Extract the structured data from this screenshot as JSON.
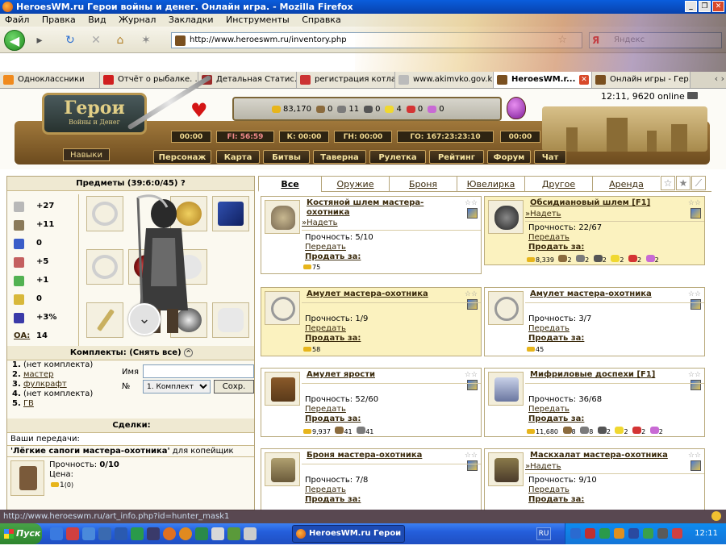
{
  "window": {
    "title": "HeroesWM.ru Герои войны и денег. Онлайн игра. - Mozilla Firefox"
  },
  "menu": [
    "Файл",
    "Правка",
    "Вид",
    "Журнал",
    "Закладки",
    "Инструменты",
    "Справка"
  ],
  "url": "http://www.heroeswm.ru/inventory.php",
  "search_placeholder": "Яндекс",
  "search_brand": "Я",
  "tabs": [
    {
      "label": "Одноклассники",
      "color": "#f08a1d"
    },
    {
      "label": "Отчёт о рыбалке. ...",
      "color": "#d01f1f"
    },
    {
      "label": "Детальная Статис...",
      "color": "#9b2a2a"
    },
    {
      "label": "регистрация котла...",
      "color": "#cc3333"
    },
    {
      "label": "www.akimvko.gov.k...",
      "color": "#bbbbbb"
    },
    {
      "label": "HeroesWM.r...",
      "color": "#7a5020"
    },
    {
      "label": "Онлайн игры - Гер...",
      "color": "#7a5020"
    }
  ],
  "game": {
    "logo": {
      "title": "Герои",
      "subtitle": "Войны и Денег"
    },
    "clock": "12:11, 9620 online",
    "resources": [
      {
        "value": "83,170",
        "color": "#e7b51b"
      },
      {
        "value": "0",
        "color": "#8b6b3d"
      },
      {
        "value": "11",
        "color": "#7b7b7b"
      },
      {
        "value": "0",
        "color": "#555555"
      },
      {
        "value": "4",
        "color": "#f0d830"
      },
      {
        "value": "0",
        "color": "#d43434"
      },
      {
        "value": "0",
        "color": "#c86ad4"
      }
    ],
    "timers": [
      "00:00",
      "00:00",
      "FI: 56:59",
      "К: 00:00",
      "ГН: 00:00",
      "ГО: 167:23:23:10",
      "00:00"
    ],
    "navy": "Навыки",
    "main_menu": [
      "Персонаж",
      "Карта",
      "Битвы",
      "Таверна",
      "Рулетка",
      "Рейтинг",
      "Форум",
      "Чат"
    ]
  },
  "left": {
    "items_header": "Предметы (39:6:0/45)",
    "help": "?",
    "stats": [
      {
        "value": "+27",
        "color": "#b8b8b8"
      },
      {
        "value": "+11",
        "color": "#8a7a5a"
      },
      {
        "value": "0",
        "color": "#3a5dc8"
      },
      {
        "value": "+5",
        "color": "#c46060"
      },
      {
        "value": "+1",
        "color": "#52b252"
      },
      {
        "value": "0",
        "color": "#d8b83a"
      },
      {
        "value": "+3%",
        "color": "#3a3aa8"
      },
      {
        "label": "ОА:",
        "value": "14",
        "color": "#ffffff"
      }
    ],
    "kits_header": "Комплекты:",
    "kits_remove": "(Снять все)",
    "kits": [
      {
        "num": "1.",
        "name": "(нет комплекта)",
        "link": false
      },
      {
        "num": "2.",
        "name": "мастер",
        "link": true
      },
      {
        "num": "3.",
        "name": "фулкрафт",
        "link": true
      },
      {
        "num": "4.",
        "name": "(нет комплекта)",
        "link": false
      },
      {
        "num": "5.",
        "name": "ГВ",
        "link": true
      }
    ],
    "kit_name_label": "Имя",
    "kit_num_label": "№",
    "kit_select": "1. Комплект",
    "kit_save": "Сохр.",
    "deals_header": "Сделки:",
    "deals_your": "Ваши передачи:",
    "deal_item": "'Лёгкие сапоги мастера-охотника'",
    "deal_for": "для копейщик",
    "deal_strength_label": "Прочность:",
    "deal_strength": "0/10",
    "deal_price_label": "Цена:",
    "deal_price": "1",
    "deal_price_extra": "(0)"
  },
  "filters": [
    "Все",
    "Оружие",
    "Броня",
    "Ювелирка",
    "Другое",
    "Аренда"
  ],
  "cards": [
    {
      "name": "Костяной шлем мастера-охотника",
      "put": "»Надеть",
      "strength": "Прочность: 5/10",
      "transfer": "Передать",
      "sell": "Продать за:",
      "price": "75",
      "highlight": false,
      "color": "#7a6a52"
    },
    {
      "name": "Обсидиановый шлем [F1]",
      "put": "»Надеть",
      "strength": "Прочность: 22/67",
      "transfer": "Передать",
      "sell": "Продать за:",
      "price": "8,339",
      "extra": [
        "2",
        "2",
        "2",
        "2",
        "2",
        "2"
      ],
      "highlight": true,
      "color": "#3c3c3c"
    },
    {
      "name": "Амулет мастера-охотника",
      "strength": "Прочность: 1/9",
      "transfer": "Передать",
      "sell": "Продать за:",
      "price": "58",
      "highlight": true,
      "color": "#c9c9c9"
    },
    {
      "name": "Амулет мастера-охотника",
      "strength": "Прочность: 3/7",
      "transfer": "Передать",
      "sell": "Продать за:",
      "price": "45",
      "highlight": false,
      "color": "#c9c9c9"
    },
    {
      "name": "Амулет ярости",
      "strength": "Прочность: 52/60",
      "transfer": "Передать",
      "sell": "Продать за:",
      "price": "9,937",
      "extra": [
        "41",
        "41"
      ],
      "highlight": false,
      "color": "#8a5a2a"
    },
    {
      "name": "Мифриловые доспехи [F1]",
      "strength": "Прочность: 36/68",
      "transfer": "Передать",
      "sell": "Продать за:",
      "price": "11,680",
      "extra": [
        "8",
        "8",
        "2",
        "2",
        "2",
        "2"
      ],
      "highlight": false,
      "color": "#9aa6c8"
    },
    {
      "name": "Броня мастера-охотника",
      "strength": "Прочность: 7/8",
      "transfer": "Передать",
      "sell": "Продать за:",
      "highlight": false,
      "color": "#8a7a4a"
    },
    {
      "name": "Маскхалат мастера-охотника",
      "put": "»Надеть",
      "strength": "Прочность: 9/10",
      "transfer": "Передать",
      "sell": "Продать за:",
      "highlight": false,
      "color": "#6a5a3a"
    }
  ],
  "status_url": "http://www.heroeswm.ru/art_info.php?id=hunter_mask1",
  "taskbar": {
    "start": "Пуск",
    "task": "HeroesWM.ru Герои вой...",
    "lang": "RU",
    "time": "12:11"
  }
}
